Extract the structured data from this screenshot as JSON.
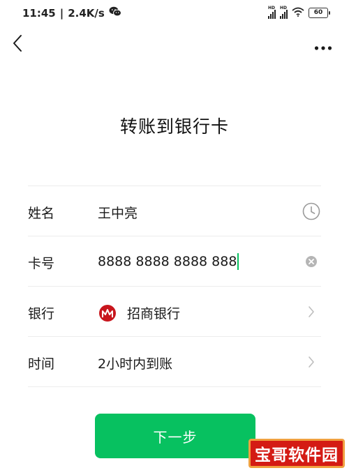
{
  "status_bar": {
    "time": "11:45",
    "separator": "|",
    "speed": "2.4K/s",
    "signal_1_label": "HD",
    "signal_2_label": "HD",
    "battery": "60",
    "app_icon": "wechat-icon"
  },
  "nav": {
    "back_icon": "chevron-left-icon",
    "more_icon": "more-dots-icon"
  },
  "page": {
    "title": "转账到银行卡"
  },
  "form": {
    "name": {
      "label": "姓名",
      "value": "王中亮",
      "trail_icon": "clock-icon"
    },
    "card": {
      "label": "卡号",
      "value": "8888 8888 8888 888",
      "trail_icon": "clear-icon"
    },
    "bank": {
      "label": "银行",
      "value": "招商银行",
      "logo_icon": "cmb-bank-logo",
      "trail_icon": "chevron-right-icon"
    },
    "time": {
      "label": "时间",
      "value": "2小时内到账",
      "trail_icon": "chevron-right-icon"
    }
  },
  "actions": {
    "next_label": "下一步"
  },
  "watermark": {
    "text": "宝哥软件园"
  },
  "colors": {
    "accent": "#07c160",
    "bank_red": "#c8161d",
    "watermark_red": "#d41b14"
  }
}
